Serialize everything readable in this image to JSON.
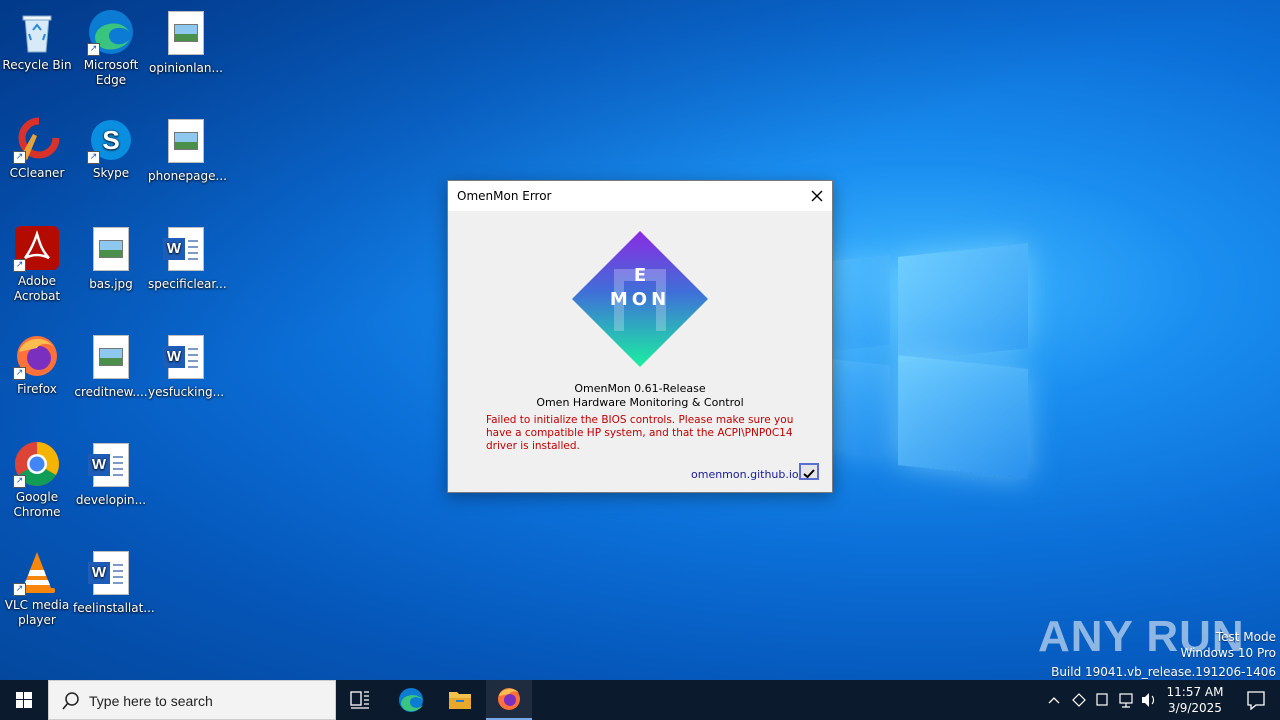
{
  "desktop": {
    "icons": [
      {
        "label": "Recycle Bin",
        "icon": "recycle-bin-icon"
      },
      {
        "label": "Microsoft Edge",
        "icon": "edge-icon"
      },
      {
        "label": "opinionlan...",
        "icon": "image-file-icon"
      },
      {
        "label": "CCleaner",
        "icon": "ccleaner-icon"
      },
      {
        "label": "Skype",
        "icon": "skype-icon"
      },
      {
        "label": "phonepage...",
        "icon": "image-file-icon"
      },
      {
        "label": "Adobe Acrobat",
        "icon": "acrobat-icon"
      },
      {
        "label": "bas.jpg",
        "icon": "image-file-icon"
      },
      {
        "label": "specificlear...",
        "icon": "word-doc-icon"
      },
      {
        "label": "Firefox",
        "icon": "firefox-icon"
      },
      {
        "label": "creditnew....",
        "icon": "image-file-icon"
      },
      {
        "label": "yesfucking...",
        "icon": "word-doc-icon"
      },
      {
        "label": "Google Chrome",
        "icon": "chrome-icon"
      },
      {
        "label": "developin...",
        "icon": "word-doc-icon"
      },
      {
        "label": "VLC media player",
        "icon": "vlc-icon"
      },
      {
        "label": "feelinstallat...",
        "icon": "word-doc-icon"
      }
    ],
    "watermark": {
      "brand": "ANY RUN",
      "line1": "Test Mode",
      "line2": "Windows 10 Pro",
      "line3": "Build 19041.vb_release.191206-1406"
    }
  },
  "dialog": {
    "title": "OmenMon Error",
    "app_name": "OmenMon 0.61-Release",
    "app_subtitle": "Omen Hardware Monitoring & Control",
    "logo_text_top": "E",
    "logo_text_bottom": "MON",
    "error_message": "Failed to initialize the BIOS controls. Please make sure you have a compatible HP system, and that the ACPI\\PNP0C14 driver is installed.",
    "link": "omenmon.github.io/",
    "ok_icon": "checkmark-icon"
  },
  "taskbar": {
    "search_placeholder": "Type here to search",
    "time": "11:57 AM",
    "date": "3/9/2025"
  },
  "colors": {
    "error_text": "#c00000",
    "link_text": "#1a1a9a",
    "taskbar_bg": "#0c1a2e"
  }
}
